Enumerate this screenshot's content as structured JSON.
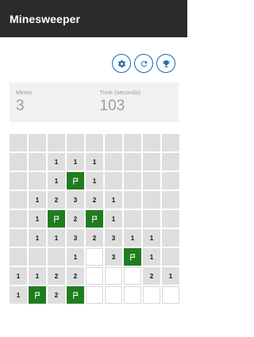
{
  "app": {
    "title": "Minesweeper"
  },
  "toolbar": {
    "buttons": [
      {
        "name": "settings-button",
        "icon": "gear-icon"
      },
      {
        "name": "restart-button",
        "icon": "refresh-icon"
      },
      {
        "name": "leaderboard-button",
        "icon": "trophy-icon"
      }
    ]
  },
  "stats": {
    "mines_label": "Mines",
    "mines_value": "3",
    "time_label": "Time (seconds)",
    "time_value": "103"
  },
  "colors": {
    "appbar": "#2b2b2b",
    "accent": "#1565c0",
    "flag": "#1f7d1f",
    "cell_unrevealed": "#dedede",
    "cell_empty": "#ffffff"
  },
  "board": {
    "rows": 9,
    "cols": 9,
    "legend": "U = unrevealed, E = revealed empty, F = flag, digit = revealed number",
    "cells": [
      [
        "U",
        "U",
        "U",
        "U",
        "U",
        "U",
        "U",
        "U",
        "U"
      ],
      [
        "U",
        "U",
        "1",
        "1",
        "1",
        "U",
        "U",
        "U",
        "U"
      ],
      [
        "U",
        "U",
        "1",
        "F",
        "1",
        "U",
        "U",
        "U",
        "U"
      ],
      [
        "U",
        "1",
        "2",
        "3",
        "2",
        "1",
        "U",
        "U",
        "U"
      ],
      [
        "U",
        "1",
        "F",
        "2",
        "F",
        "1",
        "U",
        "U",
        "U"
      ],
      [
        "U",
        "1",
        "1",
        "3",
        "2",
        "3",
        "1",
        "1",
        "U"
      ],
      [
        "U",
        "U",
        "U",
        "1",
        "E",
        "3",
        "F",
        "1",
        "U"
      ],
      [
        "1",
        "1",
        "2",
        "2",
        "E",
        "E",
        "E",
        "2",
        "1"
      ],
      [
        "1",
        "F",
        "2",
        "F",
        "E",
        "E",
        "E",
        "E",
        "E"
      ]
    ]
  }
}
